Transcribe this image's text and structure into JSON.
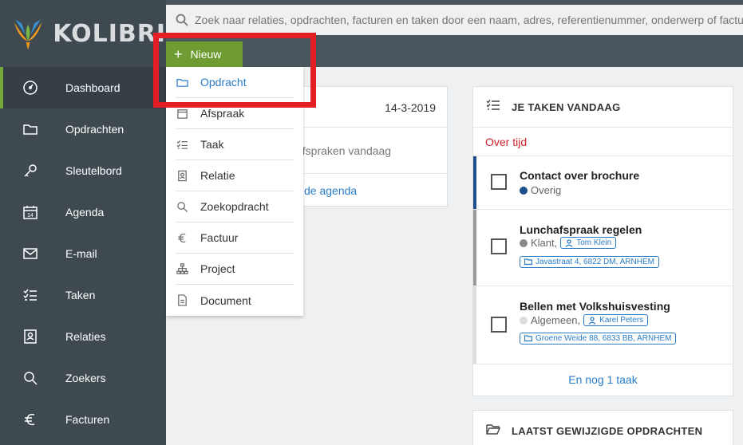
{
  "app": {
    "name": "KOLIBRI"
  },
  "search": {
    "placeholder": "Zoek naar relaties, opdrachten, facturen en taken door een naam, adres, referentienummer, onderwerp of factuurnummer"
  },
  "sidebar": {
    "items": [
      {
        "label": "Dashboard",
        "icon": "dashboard-icon",
        "active": true
      },
      {
        "label": "Opdrachten",
        "icon": "folder-icon"
      },
      {
        "label": "Sleutelbord",
        "icon": "key-icon"
      },
      {
        "label": "Agenda",
        "icon": "calendar-icon",
        "badge": "14"
      },
      {
        "label": "E-mail",
        "icon": "mail-icon"
      },
      {
        "label": "Taken",
        "icon": "checklist-icon"
      },
      {
        "label": "Relaties",
        "icon": "contact-icon"
      },
      {
        "label": "Zoekers",
        "icon": "search-icon"
      },
      {
        "label": "Facturen",
        "icon": "euro-icon"
      }
    ]
  },
  "new_button": {
    "label": "Nieuw",
    "plus": "+"
  },
  "dropdown": {
    "items": [
      {
        "label": "Opdracht",
        "icon": "folder-icon",
        "active": true
      },
      {
        "label": "Afspraak",
        "icon": "calendar-icon"
      },
      {
        "label": "Taak",
        "icon": "checklist-icon"
      },
      {
        "label": "Relatie",
        "icon": "contact-icon"
      },
      {
        "label": "Zoekopdracht",
        "icon": "search-icon"
      },
      {
        "label": "Factuur",
        "icon": "euro-icon"
      },
      {
        "label": "Project",
        "icon": "org-chart-icon"
      },
      {
        "label": "Document",
        "icon": "document-icon"
      }
    ]
  },
  "agenda_card": {
    "date": "14-3-2019",
    "empty_text": "afspraken vandaag",
    "link_text": "de agenda"
  },
  "tasks_card": {
    "title": "JE TAKEN VANDAAG",
    "overdue_label": "Over tijd",
    "tasks": [
      {
        "title": "Contact over brochure",
        "category": "Overig",
        "bar_color": "#1f4e8c",
        "dot_color": "#1f4e8c"
      },
      {
        "title": "Lunchafspraak regelen",
        "category": "Klant,",
        "person": "Tom Klein",
        "address": "Javastraat 4, 6822 DM, ARNHEM",
        "bar_color": "#9a9a9a",
        "dot_color": "#8a8a8a"
      },
      {
        "title": "Bellen met Volkshuisvesting",
        "category": "Algemeen,",
        "person": "Karel Peters",
        "address": "Groene Weide 88, 6833 BB, ARNHEM",
        "bar_color": "#dddddd",
        "dot_color": "#dddddd"
      }
    ],
    "more_link": "En nog 1 taak"
  },
  "recent_card": {
    "title": "LAATST GEWIJZIGDE OPDRACHTEN"
  },
  "colors": {
    "sidebar": "#3f4a50",
    "accent_green": "#6f9c32",
    "link_blue": "#2a7cc7",
    "overdue_red": "#d0242b",
    "highlight_red": "#e31e24"
  }
}
